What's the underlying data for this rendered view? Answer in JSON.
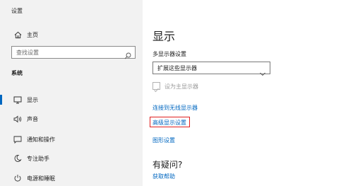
{
  "app": {
    "title": "设置"
  },
  "sidebar": {
    "home": {
      "label": "主页",
      "icon": "home-icon"
    },
    "search": {
      "placeholder": "查找设置",
      "icon": "search-icon"
    },
    "section_label": "系统",
    "items": [
      {
        "label": "显示",
        "icon": "monitor-icon",
        "active": true
      },
      {
        "label": "声音",
        "icon": "speaker-icon",
        "active": false
      },
      {
        "label": "通知和操作",
        "icon": "notification-icon",
        "active": false
      },
      {
        "label": "专注助手",
        "icon": "moon-icon",
        "active": false
      },
      {
        "label": "电源和睡眠",
        "icon": "power-icon",
        "active": false
      }
    ]
  },
  "main": {
    "title": "显示",
    "multi_display": {
      "label": "多显示器设置",
      "selected": "扩展这些显示器"
    },
    "main_display_checkbox": {
      "label": "设为主显示器",
      "checked": true,
      "disabled": true
    },
    "links": {
      "wireless": "连接到无线显示器",
      "advanced": "高级显示设置",
      "graphics": "图形设置"
    },
    "help": {
      "title": "有疑问?",
      "link": "获取帮助"
    }
  },
  "colors": {
    "accent": "#0067c0",
    "highlight": "#e02020",
    "sidebar_bg": "#f2f2f2"
  }
}
